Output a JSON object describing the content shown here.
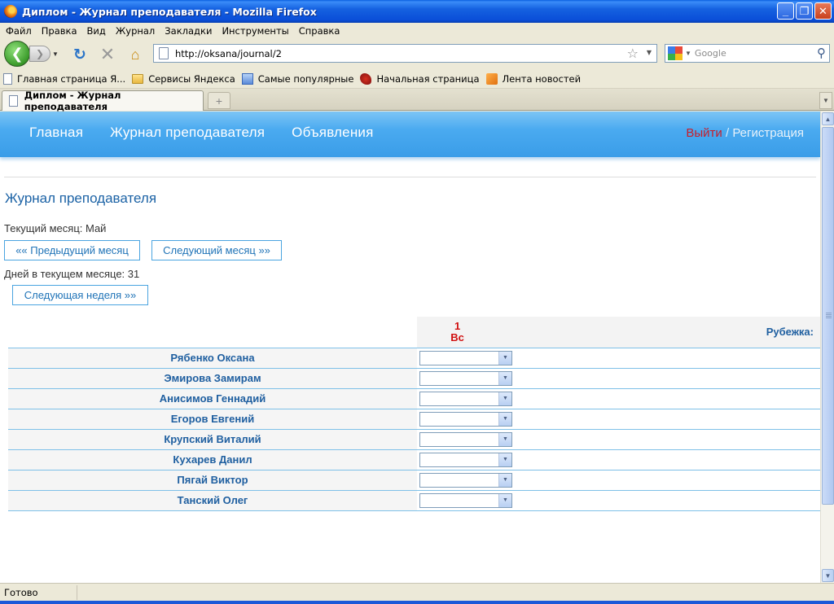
{
  "window": {
    "title": "Диплом - Журнал преподавателя - Mozilla Firefox"
  },
  "menu": [
    "Файл",
    "Правка",
    "Вид",
    "Журнал",
    "Закладки",
    "Инструменты",
    "Справка"
  ],
  "toolbar": {
    "url": "http://oksana/journal/2",
    "search_placeholder": "Google"
  },
  "bookmarks": [
    {
      "label": "Главная страница Я...",
      "icon": "page-icon"
    },
    {
      "label": "Сервисы Яндекса",
      "icon": "folder-icon"
    },
    {
      "label": "Самые популярные",
      "icon": "bookmark-icon"
    },
    {
      "label": "Начальная страница",
      "icon": "globe-icon"
    },
    {
      "label": "Лента новостей",
      "icon": "rss-icon"
    }
  ],
  "tab": {
    "title": "Диплом - Журнал преподавателя"
  },
  "site": {
    "nav": [
      "Главная",
      "Журнал преподавателя",
      "Объявления"
    ],
    "logout": "Выйти",
    "separator": "/",
    "register": "Регистрация"
  },
  "page": {
    "title": "Журнал преподавателя",
    "current_month": "Текущий месяц: Май",
    "prev_month": "«« Предыдущий месяц",
    "next_month": "Следующий месяц »»",
    "days_in_month": "Дней в текущем месяце: 31",
    "next_week": "Следующая неделя »»"
  },
  "journal": {
    "day_number": "1",
    "day_name": "Вс",
    "checkpoint_label": "Рубежка:",
    "students": [
      "Рябенко Оксана",
      "Эмирова Замирам",
      "Анисимов Геннадий",
      "Егоров Евгений",
      "Крупский Виталий",
      "Кухарев Данил",
      "Пягай Виктор",
      "Танский Олег"
    ]
  },
  "status": {
    "text": "Готово"
  },
  "colors": {
    "accent": "#1b62a5",
    "header": "#4aaaf0",
    "logout": "#c81e2a",
    "day": "#d01010"
  }
}
